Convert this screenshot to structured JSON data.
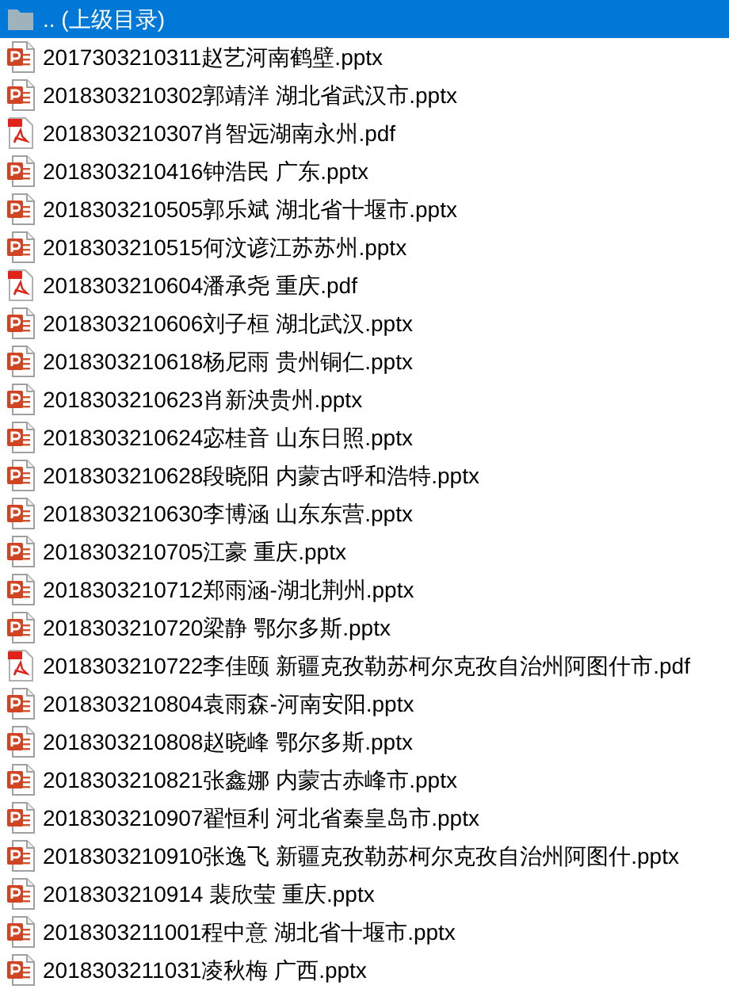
{
  "files": [
    {
      "kind": "parent",
      "name": ".. (上级目录)",
      "selected": true
    },
    {
      "kind": "pptx",
      "name": "2017303210311赵艺河南鹤壁.pptx",
      "selected": false
    },
    {
      "kind": "pptx",
      "name": "2018303210302郭靖洋 湖北省武汉市.pptx",
      "selected": false
    },
    {
      "kind": "pdf",
      "name": "2018303210307肖智远湖南永州.pdf",
      "selected": false
    },
    {
      "kind": "pptx",
      "name": "2018303210416钟浩民 广东.pptx",
      "selected": false
    },
    {
      "kind": "pptx",
      "name": "2018303210505郭乐斌 湖北省十堰市.pptx",
      "selected": false
    },
    {
      "kind": "pptx",
      "name": "2018303210515何汶谚江苏苏州.pptx",
      "selected": false
    },
    {
      "kind": "pdf",
      "name": "2018303210604潘承尧 重庆.pdf",
      "selected": false
    },
    {
      "kind": "pptx",
      "name": "2018303210606刘子桓 湖北武汉.pptx",
      "selected": false
    },
    {
      "kind": "pptx",
      "name": "2018303210618杨尼雨 贵州铜仁.pptx",
      "selected": false
    },
    {
      "kind": "pptx",
      "name": "2018303210623肖新泱贵州.pptx",
      "selected": false
    },
    {
      "kind": "pptx",
      "name": "2018303210624宓桂音 山东日照.pptx",
      "selected": false
    },
    {
      "kind": "pptx",
      "name": "2018303210628段晓阳 内蒙古呼和浩特.pptx",
      "selected": false
    },
    {
      "kind": "pptx",
      "name": "2018303210630李博涵 山东东营.pptx",
      "selected": false
    },
    {
      "kind": "pptx",
      "name": "2018303210705江豪 重庆.pptx",
      "selected": false
    },
    {
      "kind": "pptx",
      "name": "2018303210712郑雨涵-湖北荆州.pptx",
      "selected": false
    },
    {
      "kind": "pptx",
      "name": "2018303210720梁静 鄂尔多斯.pptx",
      "selected": false
    },
    {
      "kind": "pdf",
      "name": "2018303210722李佳颐  新疆克孜勒苏柯尔克孜自治州阿图什市.pdf",
      "selected": false
    },
    {
      "kind": "pptx",
      "name": "2018303210804袁雨森-河南安阳.pptx",
      "selected": false
    },
    {
      "kind": "pptx",
      "name": "2018303210808赵晓峰 鄂尔多斯.pptx",
      "selected": false
    },
    {
      "kind": "pptx",
      "name": "2018303210821张鑫娜 内蒙古赤峰市.pptx",
      "selected": false
    },
    {
      "kind": "pptx",
      "name": "2018303210907翟恒利 河北省秦皇岛市.pptx",
      "selected": false
    },
    {
      "kind": "pptx",
      "name": "2018303210910张逸飞 新疆克孜勒苏柯尔克孜自治州阿图什.pptx",
      "selected": false
    },
    {
      "kind": "pptx",
      "name": "2018303210914 裴欣莹 重庆.pptx",
      "selected": false
    },
    {
      "kind": "pptx",
      "name": "2018303211001程中意 湖北省十堰市.pptx",
      "selected": false
    },
    {
      "kind": "pptx",
      "name": "2018303211031凌秋梅 广西.pptx",
      "selected": false
    }
  ]
}
